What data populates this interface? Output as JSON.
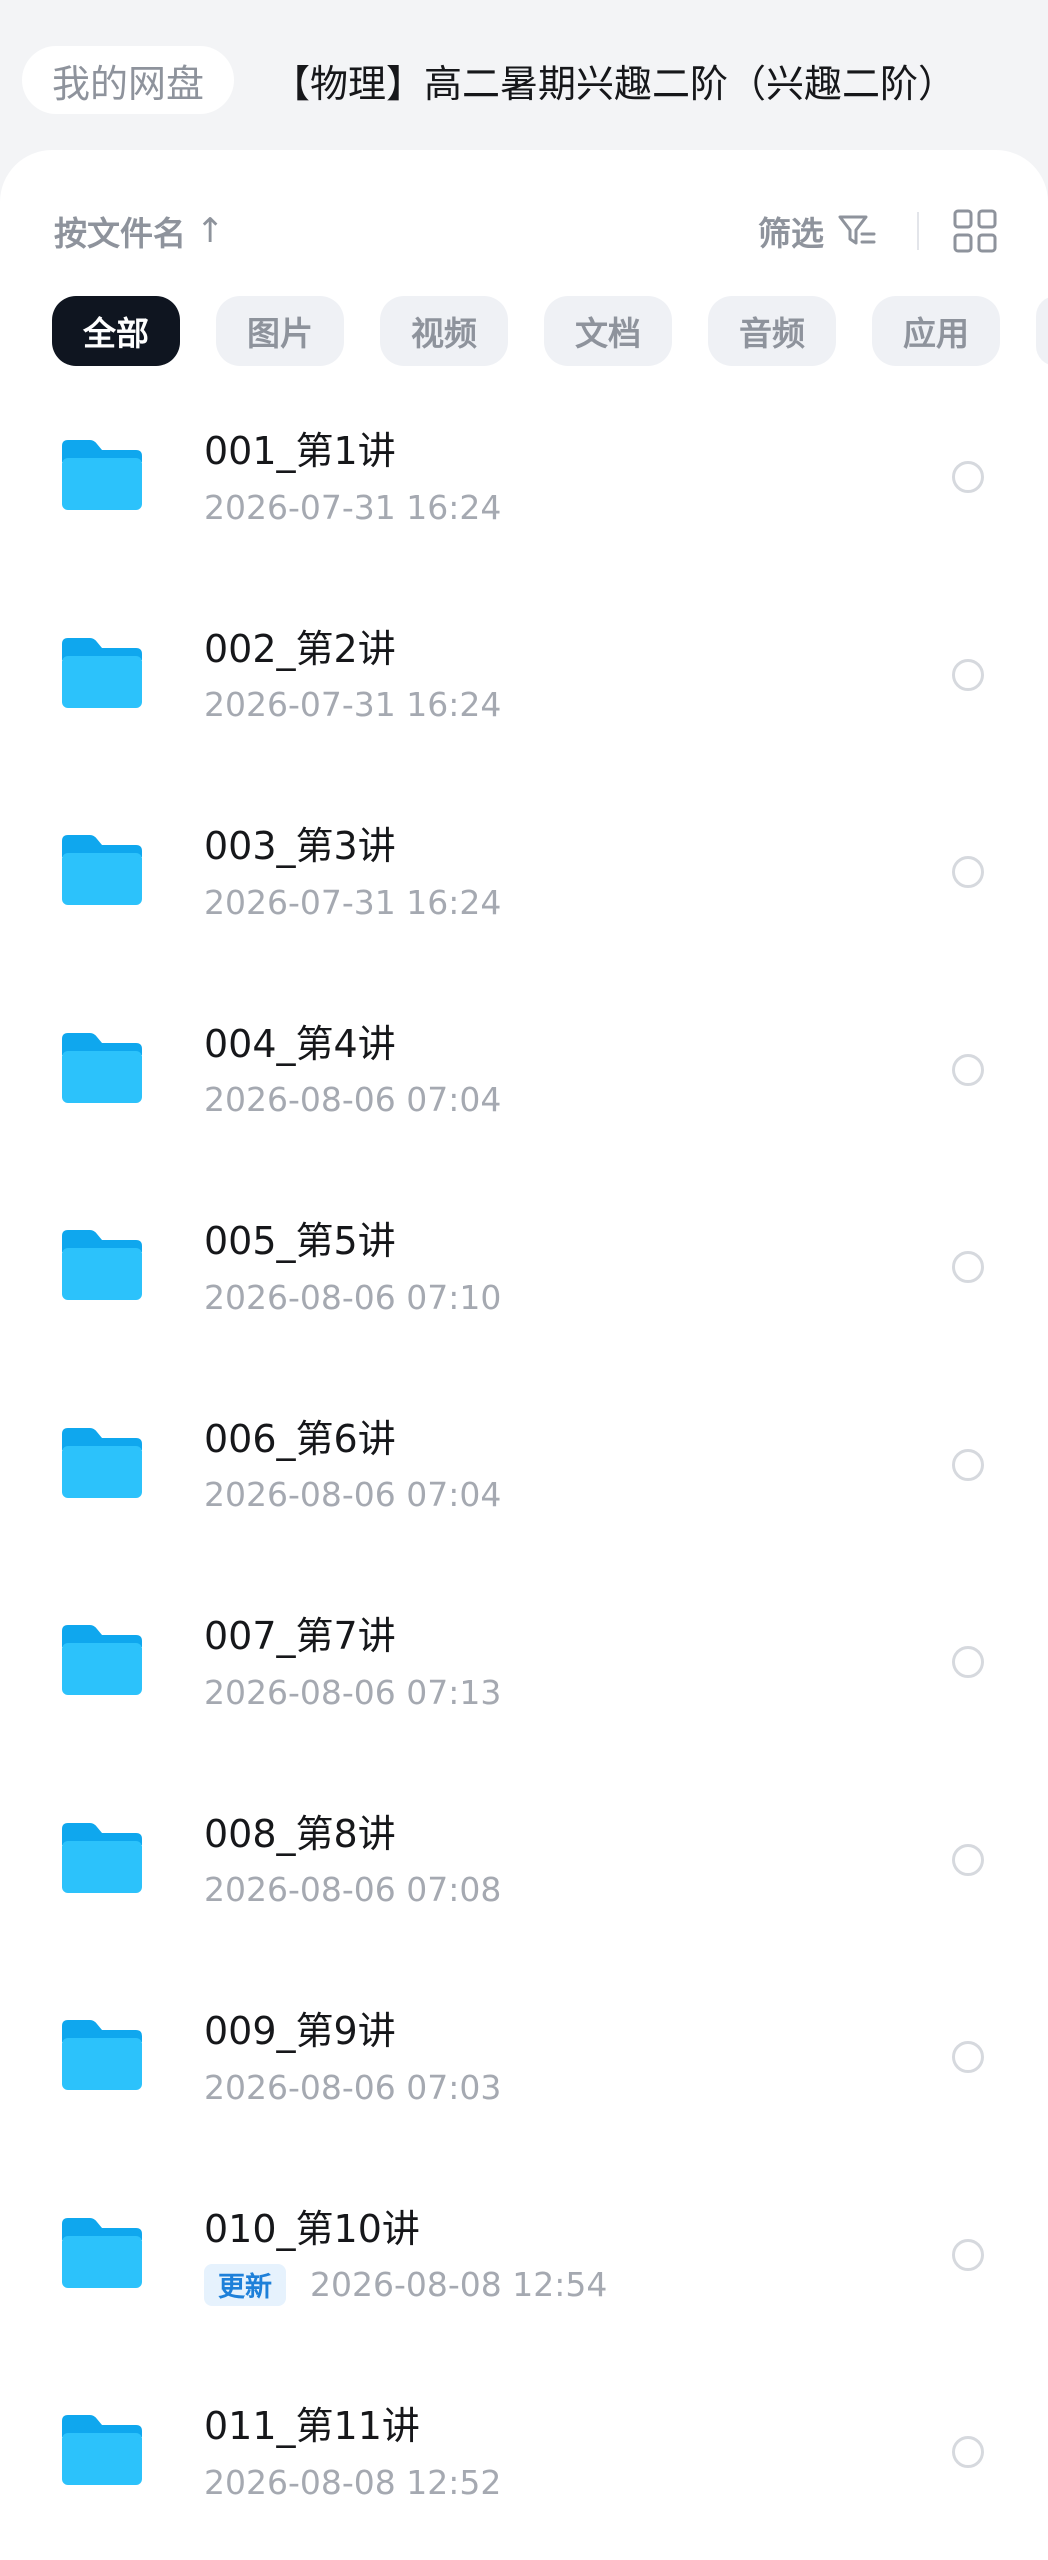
{
  "header": {
    "home_label": "我的网盘",
    "current_folder": "【物理】高二暑期兴趣二阶（兴趣二阶）"
  },
  "toolbar": {
    "sort_label": "按文件名",
    "sort_arrow": "↑",
    "filter_label": "筛选"
  },
  "chips": [
    {
      "label": "全部",
      "active": true
    },
    {
      "label": "图片",
      "active": false
    },
    {
      "label": "视频",
      "active": false
    },
    {
      "label": "文档",
      "active": false
    },
    {
      "label": "音频",
      "active": false
    },
    {
      "label": "应用",
      "active": false
    }
  ],
  "files": [
    {
      "name": "001_第1讲",
      "date": "2026-07-31  16:24",
      "badge": null
    },
    {
      "name": "002_第2讲",
      "date": "2026-07-31  16:24",
      "badge": null
    },
    {
      "name": "003_第3讲",
      "date": "2026-07-31  16:24",
      "badge": null
    },
    {
      "name": "004_第4讲",
      "date": "2026-08-06  07:04",
      "badge": null
    },
    {
      "name": "005_第5讲",
      "date": "2026-08-06  07:10",
      "badge": null
    },
    {
      "name": "006_第6讲",
      "date": "2026-08-06  07:04",
      "badge": null
    },
    {
      "name": "007_第7讲",
      "date": "2026-08-06  07:13",
      "badge": null
    },
    {
      "name": "008_第8讲",
      "date": "2026-08-06  07:08",
      "badge": null
    },
    {
      "name": "009_第9讲",
      "date": "2026-08-06  07:03",
      "badge": null
    },
    {
      "name": "010_第10讲",
      "date": "2026-08-08  12:54",
      "badge": "更新"
    },
    {
      "name": "011_第11讲",
      "date": "2026-08-08  12:52",
      "badge": null
    }
  ],
  "icons": {
    "folder": "folder-icon",
    "filter": "filter-icon",
    "grid": "grid-view-icon",
    "select": "select-circle-icon"
  },
  "colors": {
    "folder": "#1cb8f7",
    "active_chip": "#0f1520",
    "badge_text": "#1e80d9",
    "badge_bg": "#e6f2fd"
  }
}
